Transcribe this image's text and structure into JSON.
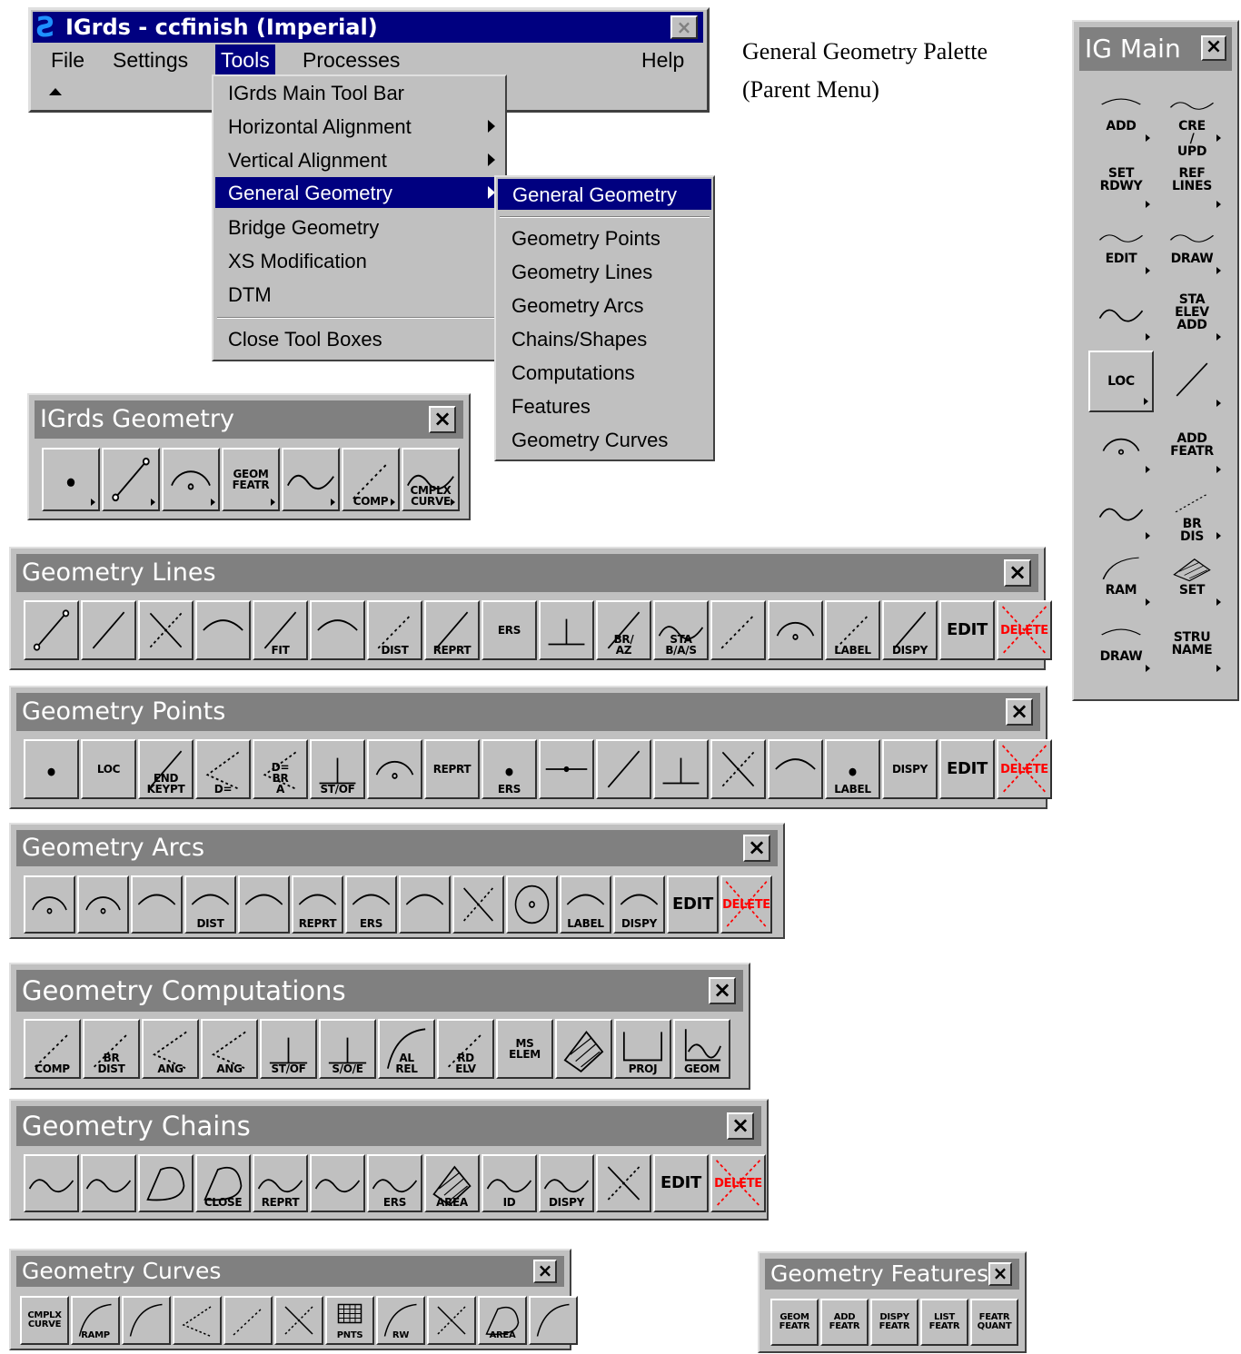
{
  "main_window": {
    "title": "IGrds - ccfinish (Imperial)",
    "menus": [
      "File",
      "Settings",
      "Tools",
      "Processes",
      "Help"
    ],
    "tools_menu": [
      "IGrds Main Tool Bar",
      "Horizontal Alignment",
      "Vertical Alignment",
      "General Geometry",
      "Bridge Geometry",
      "XS Modification",
      "DTM",
      "Close Tool Boxes"
    ],
    "gg_submenu": [
      "General Geometry",
      "Geometry Points",
      "Geometry Lines",
      "Geometry Arcs",
      "Chains/Shapes",
      "Computations",
      "Features",
      "Geometry Curves"
    ]
  },
  "caption": {
    "line1": "General Geometry Palette",
    "line2": "(Parent Menu)"
  },
  "close_glyph": "×",
  "igrds_geometry": {
    "title": "IGrds Geometry",
    "labels": [
      "",
      "",
      "",
      "GEOM FEATR",
      "",
      "COMP",
      "CMPLX CURVE"
    ]
  },
  "geometry_lines": {
    "title": "Geometry Lines",
    "labels": [
      "",
      "",
      "",
      "",
      "FIT",
      "",
      "DIST",
      "REPRT",
      "ERS",
      "",
      "BR/ AZ",
      "STA B/A/S",
      "",
      "",
      "LABEL",
      "DISPY",
      "EDIT",
      "DELETE"
    ]
  },
  "geometry_points": {
    "title": "Geometry Points",
    "labels": [
      "",
      "LOC",
      "END KEYPT",
      "D=",
      "D= BR A",
      "ST/OF",
      "",
      "REPRT",
      "ERS",
      "",
      "",
      "",
      "",
      "",
      "LABEL",
      "DISPY",
      "EDIT",
      "DELETE"
    ]
  },
  "geometry_arcs": {
    "title": "Geometry Arcs",
    "labels": [
      "",
      "",
      "",
      "DIST",
      "",
      "REPRT",
      "ERS",
      "",
      "",
      "",
      "LABEL",
      "DISPY",
      "EDIT",
      "DELETE"
    ]
  },
  "geometry_computations": {
    "title": "Geometry Computations",
    "labels": [
      "COMP",
      "BR DIST",
      "ANG",
      "ANG",
      "ST/OF",
      "S/O/E",
      "AL REL",
      "RD ELV",
      "MS ELEM",
      "",
      "PROJ",
      "GEOM"
    ]
  },
  "geometry_chains": {
    "title": "Geometry Chains",
    "labels": [
      "",
      "",
      "",
      "CLOSE",
      "REPRT",
      "",
      "ERS",
      "AREA",
      "ID",
      "DISPY",
      "",
      "EDIT",
      "DELETE"
    ]
  },
  "geometry_curves": {
    "title": "Geometry Curves",
    "labels": [
      "CMPLX CURVE",
      "RAMP",
      "",
      "",
      "",
      "",
      "PNTS",
      "RW",
      "",
      "AREA",
      ""
    ]
  },
  "geometry_features": {
    "title": "Geometry Features",
    "labels": [
      "GEOM FEATR",
      "ADD FEATR",
      "DISPY FEATR",
      "LIST FEATR",
      "FEATR QUANT"
    ]
  },
  "ig_main": {
    "title": "IG Main",
    "labels": [
      "ADD",
      "CRE / UPD",
      "SET RDWY",
      "REF LINES",
      "EDIT",
      "DRAW",
      "",
      "STA ELEV ADD",
      "LOC",
      "",
      "",
      "ADD FEATR",
      "",
      "BR DIS",
      "RAM",
      "SET",
      "DRAW",
      "STRU NAME"
    ]
  }
}
